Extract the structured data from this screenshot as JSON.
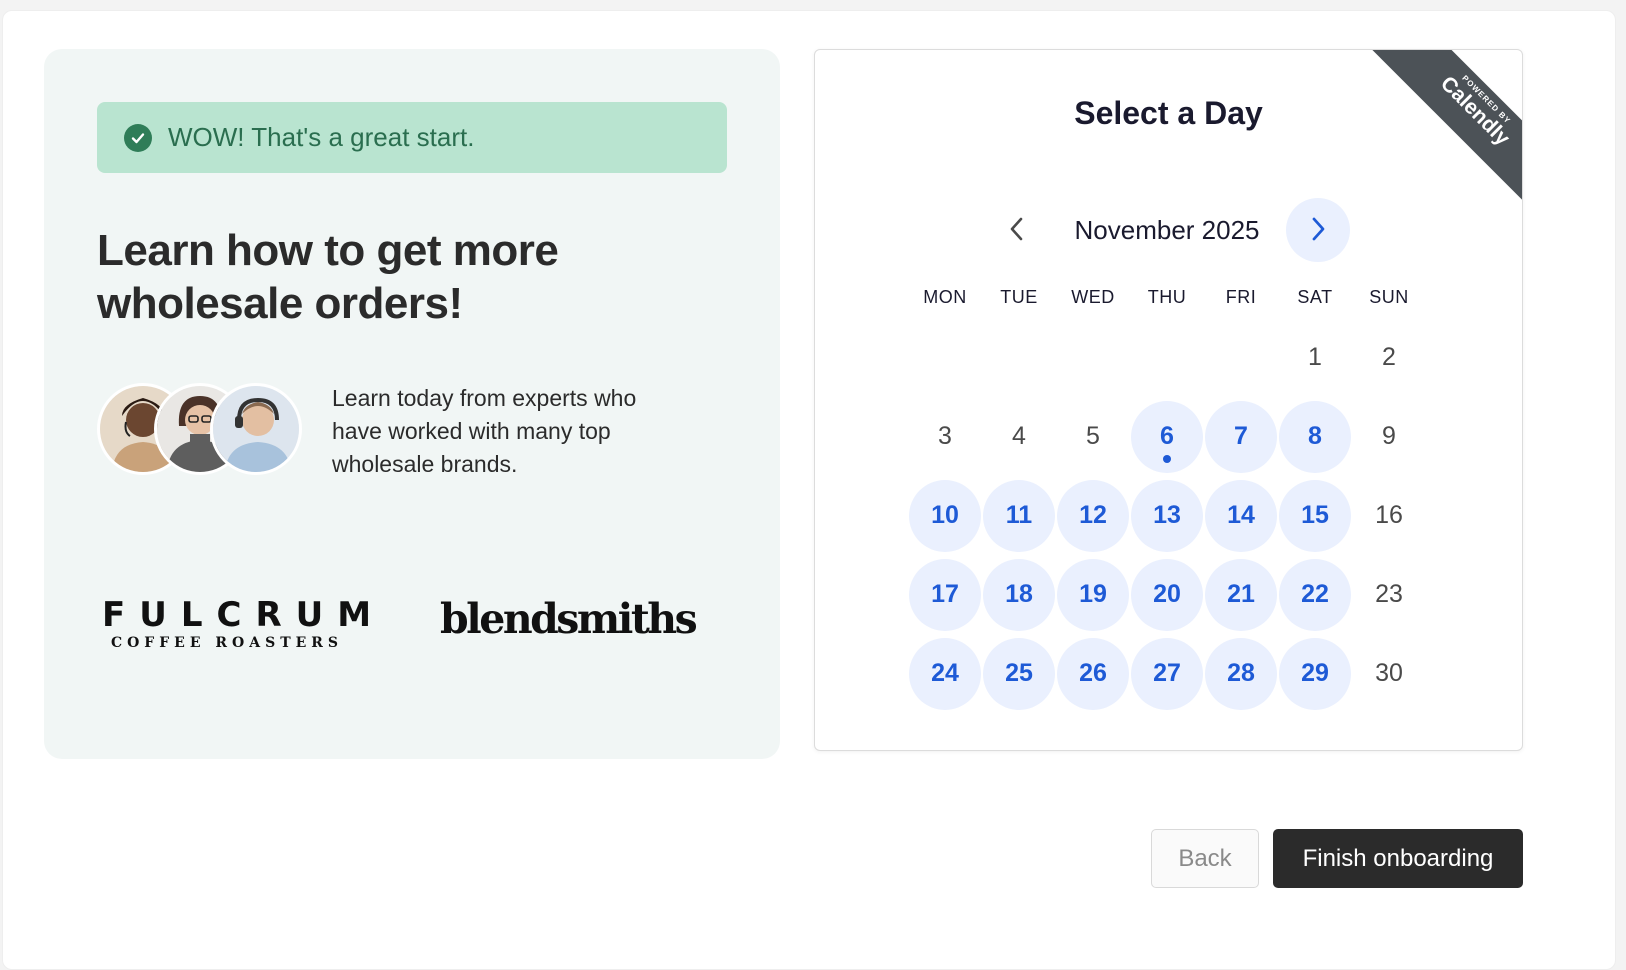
{
  "promo": {
    "alert_text": "WOW! That's a great start.",
    "headline": "Learn how to get more wholesale orders!",
    "experts_text": "Learn today from experts who have worked with many top wholesale brands.",
    "logos": {
      "fulcrum_main": "FULCRUM",
      "fulcrum_sub": "COFFEE ROASTERS",
      "blendsmiths": "blendsmiths"
    }
  },
  "calendar": {
    "title": "Select a Day",
    "ribbon_powered": "POWERED BY",
    "ribbon_brand": "Calendly",
    "month_label": "November 2025",
    "weekdays": [
      "MON",
      "TUE",
      "WED",
      "THU",
      "FRI",
      "SAT",
      "SUN"
    ],
    "days": [
      {
        "n": "",
        "avail": false
      },
      {
        "n": "",
        "avail": false
      },
      {
        "n": "",
        "avail": false
      },
      {
        "n": "",
        "avail": false
      },
      {
        "n": "",
        "avail": false
      },
      {
        "n": "1",
        "avail": false
      },
      {
        "n": "2",
        "avail": false
      },
      {
        "n": "3",
        "avail": false
      },
      {
        "n": "4",
        "avail": false
      },
      {
        "n": "5",
        "avail": false
      },
      {
        "n": "6",
        "avail": true,
        "today": true
      },
      {
        "n": "7",
        "avail": true
      },
      {
        "n": "8",
        "avail": true
      },
      {
        "n": "9",
        "avail": false
      },
      {
        "n": "10",
        "avail": true
      },
      {
        "n": "11",
        "avail": true
      },
      {
        "n": "12",
        "avail": true
      },
      {
        "n": "13",
        "avail": true
      },
      {
        "n": "14",
        "avail": true
      },
      {
        "n": "15",
        "avail": true
      },
      {
        "n": "16",
        "avail": false
      },
      {
        "n": "17",
        "avail": true
      },
      {
        "n": "18",
        "avail": true
      },
      {
        "n": "19",
        "avail": true
      },
      {
        "n": "20",
        "avail": true
      },
      {
        "n": "21",
        "avail": true
      },
      {
        "n": "22",
        "avail": true
      },
      {
        "n": "23",
        "avail": false
      },
      {
        "n": "24",
        "avail": true
      },
      {
        "n": "25",
        "avail": true
      },
      {
        "n": "26",
        "avail": true
      },
      {
        "n": "27",
        "avail": true
      },
      {
        "n": "28",
        "avail": true
      },
      {
        "n": "29",
        "avail": true
      },
      {
        "n": "30",
        "avail": false
      }
    ]
  },
  "footer": {
    "back_label": "Back",
    "finish_label": "Finish onboarding"
  },
  "icons": {
    "alert": "check-circle-icon",
    "prev": "chevron-left-icon",
    "next": "chevron-right-icon"
  },
  "colors": {
    "accent_blue": "#1e5ad6",
    "available_day_bg": "#eaf0fe",
    "alert_bg": "#b9e4d0",
    "alert_text": "#2a6e4f",
    "promo_bg": "#f1f6f5",
    "primary_button": "#2b2b2b"
  }
}
